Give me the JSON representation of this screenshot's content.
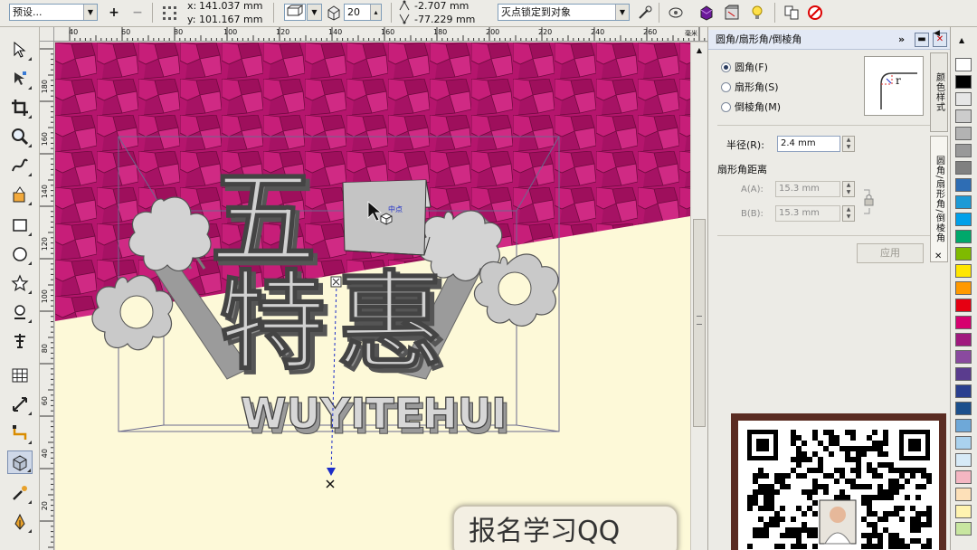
{
  "property_bar": {
    "preset_label": "预设...",
    "x_label": "x:",
    "x_value": "141.037 mm",
    "y_label": "y:",
    "y_value": "101.167 mm",
    "depth_value": "20",
    "vp_x_value": "-2.707 mm",
    "vp_y_value": "-77.229 mm",
    "vanishing_point_mode": "灭点锁定到对象"
  },
  "ruler": {
    "h_ticks": [
      "40",
      "60",
      "80",
      "100",
      "120",
      "140",
      "160",
      "180",
      "200",
      "220",
      "240",
      "260"
    ],
    "unit_label": "毫米",
    "v_ticks": [
      "180",
      "160",
      "140",
      "120",
      "100",
      "80",
      "60",
      "40",
      "20"
    ]
  },
  "canvas": {
    "title_chars": [
      "五",
      "特",
      "惠"
    ],
    "subtitle": "WUYITEHUI",
    "center_label": "中点"
  },
  "docker": {
    "title": "圆角/扇形角/倒棱角",
    "options": [
      {
        "label": "圆角(F)",
        "selected": true
      },
      {
        "label": "扇形角(S)",
        "selected": false
      },
      {
        "label": "倒棱角(M)",
        "selected": false
      }
    ],
    "radius_label": "半径(R):",
    "radius_value": "2.4 mm",
    "scallop_section": "扇形角距离",
    "a_label": "A(A):",
    "a_value": "15.3 mm",
    "b_label": "B(B):",
    "b_value": "15.3 mm",
    "apply_label": "应用",
    "preview_label": "r",
    "side_tabs": [
      "颜色样式",
      "圆角/扇形角/倒棱角"
    ]
  },
  "palette": {
    "colors": [
      "#ffffff",
      "#000000",
      "#e6e6e6",
      "#cccccc",
      "#b3b3b3",
      "#999999",
      "#808080",
      "#2e6db4",
      "#1c9ad6",
      "#00a0e9",
      "#00a86b",
      "#7fba00",
      "#ffe600",
      "#ff9900",
      "#e60012",
      "#d6006f",
      "#a0187e",
      "#8a4a9f",
      "#5a3c8e",
      "#2a3f8f",
      "#1b4f8c",
      "#6ea8d8",
      "#aad2ee",
      "#d7eaf7",
      "#f4b6c2",
      "#fde0b8",
      "#fff3b0",
      "#c8e6a0"
    ]
  },
  "overlay": {
    "banner_text": "报名学习QQ"
  },
  "colors": {
    "magenta_bg": "#b5156d",
    "cream_bg": "#fdf9d8",
    "extrude_grey": "#b8b8b8"
  }
}
